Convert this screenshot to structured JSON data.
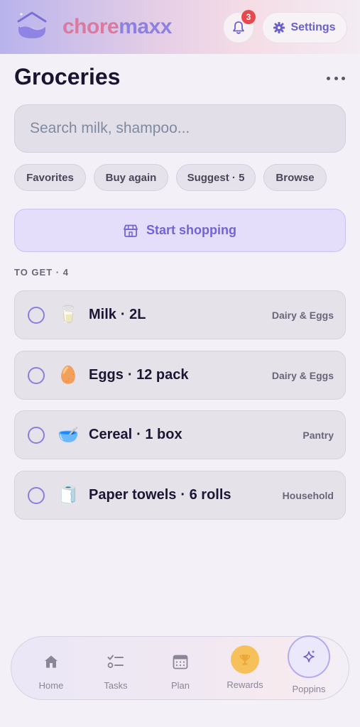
{
  "app": {
    "brand_part1": "chore",
    "brand_part2": "maxx",
    "notification_count": "3",
    "settings_label": "Settings"
  },
  "page": {
    "title": "Groceries"
  },
  "search": {
    "placeholder": "Search milk, shampoo..."
  },
  "chips": [
    {
      "label": "Favorites"
    },
    {
      "label": "Buy again"
    },
    {
      "label": "Suggest · 5"
    },
    {
      "label": "Browse"
    }
  ],
  "start_shopping": {
    "label": "Start shopping"
  },
  "section": {
    "label": "TO GET · 4"
  },
  "items": [
    {
      "emoji": "🥛",
      "name": "Milk",
      "qty": "· 2L",
      "category": "Dairy & Eggs",
      "checked": false
    },
    {
      "emoji": "🥚",
      "name": "Eggs",
      "qty": "· 12 pack",
      "category": "Dairy & Eggs",
      "checked": false
    },
    {
      "emoji": "🥣",
      "name": "Cereal",
      "qty": "· 1 box",
      "category": "Pantry",
      "checked": false
    },
    {
      "emoji": "🧻",
      "name": "Paper towels",
      "qty": "· 6 rolls",
      "category": "Household",
      "checked": false
    }
  ],
  "nav": [
    {
      "label": "Home",
      "icon": "home-icon"
    },
    {
      "label": "Tasks",
      "icon": "tasks-icon"
    },
    {
      "label": "Plan",
      "icon": "calendar-icon"
    },
    {
      "label": "Rewards",
      "icon": "trophy-icon"
    },
    {
      "label": "Poppins",
      "icon": "sparkle-icon"
    }
  ],
  "colors": {
    "accent": "#7264d6",
    "brand_pink": "#d97a9e",
    "brand_purple": "#8d80e0",
    "badge": "#e5484d"
  }
}
